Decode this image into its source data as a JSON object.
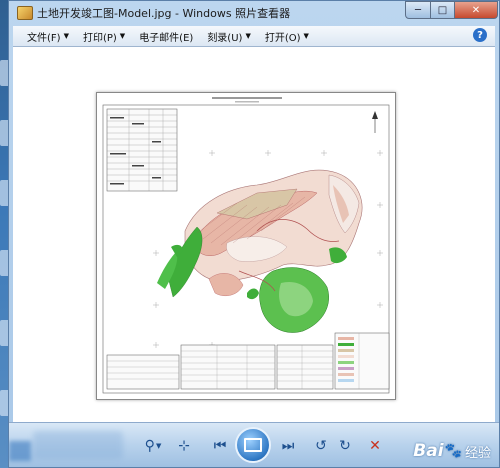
{
  "window": {
    "title": "土地开发竣工图-Model.jpg - Windows 照片查看器",
    "minimize_glyph": "─",
    "maximize_glyph": "□",
    "close_glyph": "✕"
  },
  "menu": {
    "items": [
      {
        "label": "文件(F)",
        "arrow": "▼"
      },
      {
        "label": "打印(P)",
        "arrow": "▼"
      },
      {
        "label": "电子邮件(E)",
        "arrow": ""
      },
      {
        "label": "刻录(U)",
        "arrow": "▼"
      },
      {
        "label": "打开(O)",
        "arrow": "▼"
      }
    ],
    "help_glyph": "?"
  },
  "toolbar": {
    "zoom_glyph": "⚲",
    "zoom_arrow": "▼",
    "fit_glyph": "⊹",
    "prev_glyph": "⏮",
    "next_glyph": "⏭",
    "rotate_ccw_glyph": "↺",
    "rotate_cw_glyph": "↻",
    "delete_glyph": "✕"
  },
  "watermark": {
    "bai": "Bai",
    "paw": "🐾",
    "du_cn": "经验"
  },
  "colors": {
    "accent": "#2f78c4",
    "close": "#c64a2e",
    "map_green": "#3fae3a",
    "map_pink": "#e7b6a6",
    "map_tan": "#d8c6a6"
  }
}
